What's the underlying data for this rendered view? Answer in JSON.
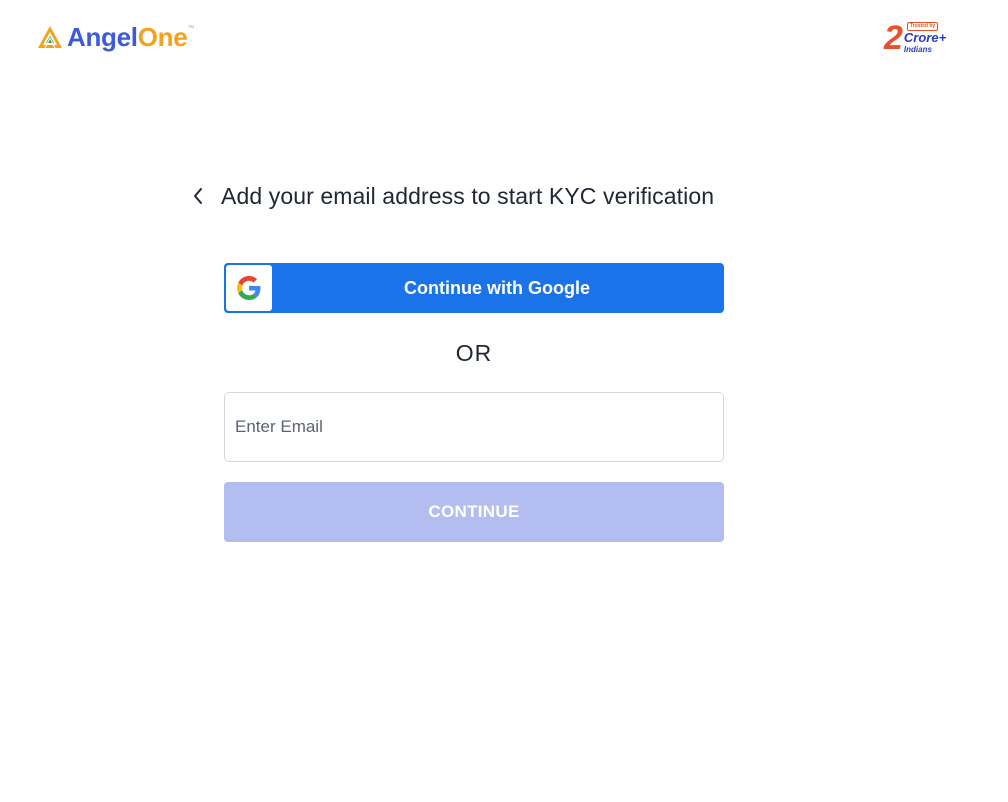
{
  "header": {
    "logo_text_primary": "Angel",
    "logo_text_secondary": "One",
    "logo_tm": "™",
    "badge": {
      "number": "2",
      "trusted": "Trusted by",
      "crore": "Crore+",
      "indians": "Indians"
    }
  },
  "main": {
    "title": "Add your email address to start KYC verification",
    "google_button_label": "Continue with Google",
    "or_text": "OR",
    "email_placeholder": "Enter Email",
    "email_value": "",
    "continue_label": "CONTINUE",
    "continue_enabled": false
  },
  "colors": {
    "brand_blue": "#3b5bdb",
    "brand_orange": "#f4a21c",
    "google_blue": "#1a73e8",
    "continue_disabled": "#b3bdef"
  },
  "icons": [
    "angelone-logo-icon",
    "back-chevron-icon",
    "google-g-icon"
  ]
}
